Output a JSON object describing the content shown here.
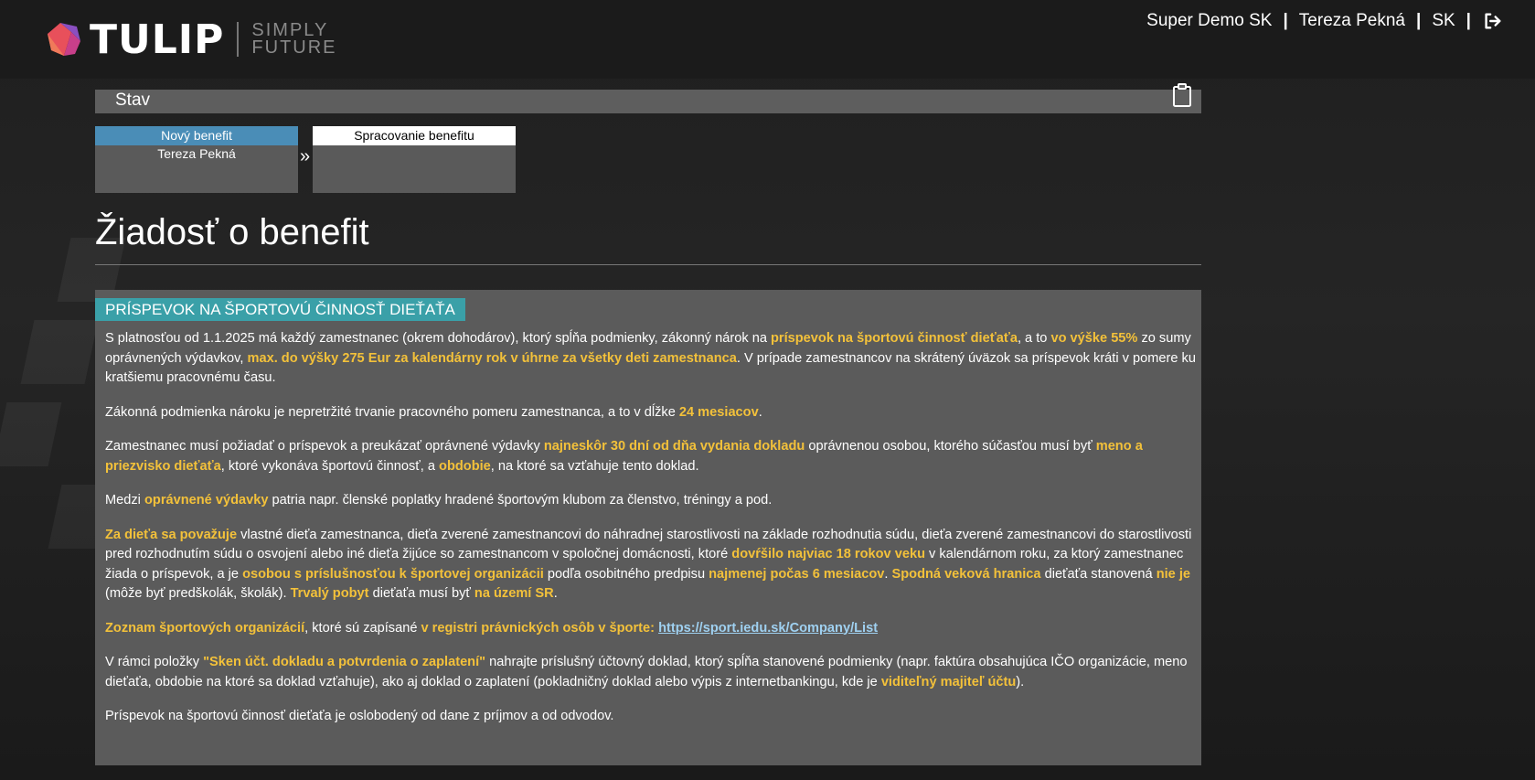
{
  "header": {
    "logo_text": "TULIP",
    "logo_tag_line1": "SIMPLY",
    "logo_tag_line2": "FUTURE",
    "company": "Super Demo SK",
    "user": "Tereza Pekná",
    "language": "SK",
    "logout_icon": "logout-icon"
  },
  "stav": {
    "title": "Stav",
    "icon": "clipboard-icon"
  },
  "workflow": {
    "steps": [
      {
        "label": "Nový benefit",
        "sub": "Tereza Pekná",
        "active": true
      },
      {
        "label": "Spracovanie benefitu",
        "sub": "",
        "active": false
      }
    ],
    "arrow": "»"
  },
  "page": {
    "title": "Žiadosť o benefit"
  },
  "section": {
    "badge": "PRÍSPEVOK NA ŠPORTOVÚ ČINNOSŤ DIEŤAŤA",
    "p1": {
      "a": "S platnosťou od 1.1.2025 má každý zamestnanec (okrem dohodárov), ktorý spĺňa podmienky, zákonný nárok na ",
      "b": "príspevok na športovú činnosť dieťaťa",
      "c": ", a to ",
      "d": "vo výške 55%",
      "e": " zo sumy oprávnených výdavkov, ",
      "f": "max. do výšky 275 Eur za kalendárny rok v úhrne za všetky deti zamestnanca",
      "g": ". V prípade zamestnancov na skrátený úväzok sa príspevok kráti v pomere ku kratšiemu pracovnému času."
    },
    "p2": {
      "a": "Zákonná podmienka nároku je nepretržité trvanie pracovného pomeru zamestnanca, a to v dĺžke ",
      "b": "24 mesiacov",
      "c": "."
    },
    "p3": {
      "a": "Zamestnanec musí požiadať o príspevok a preukázať oprávnené výdavky ",
      "b": "najneskôr 30 dní od dňa vydania dokladu",
      "c": " oprávnenou osobou, ktorého súčasťou musí byť ",
      "d": "meno a priezvisko dieťaťa",
      "e": ", ktoré vykonáva športovú činnosť, a ",
      "f": "obdobie",
      "g": ", na ktoré sa vzťahuje tento doklad."
    },
    "p4": {
      "a": "Medzi ",
      "b": "oprávnené výdavky",
      "c": " patria napr. členské poplatky hradené športovým klubom za členstvo, tréningy a pod."
    },
    "p5": {
      "a": "Za dieťa sa považuje",
      "b": " vlastné dieťa zamestnanca, dieťa zverené zamestnancovi do náhradnej starostlivosti na základe rozhodnutia súdu, dieťa zverené zamestnancovi do starostlivosti pred rozhodnutím súdu o osvojení alebo iné dieťa žijúce so zamestnancom v spoločnej domácnosti, ktoré ",
      "c": "dovŕšilo najviac 18 rokov veku",
      "d": " v kalendárnom roku, za ktorý zamestnanec žiada o príspevok, a je ",
      "e": "osobou s príslušnosťou k športovej organizácii",
      "f": " podľa osobitného predpisu ",
      "g": "najmenej počas 6 mesiacov",
      "h": ". ",
      "i": "Spodná veková hranica",
      "j": " dieťaťa stanovená ",
      "k": "nie je",
      "l": " (môže byť predškolák, školák). ",
      "m": "Trvalý pobyt",
      "n": " dieťaťa musí byť ",
      "o": "na území SR",
      "p": "."
    },
    "p6": {
      "a": "Zoznam športových organizácií",
      "b": ", ktoré sú zapísané ",
      "c": "v registri právnických osôb v športe:",
      "d": " ",
      "link": "https://sport.iedu.sk/Company/List"
    },
    "p7": {
      "a": "V rámci položky ",
      "b": "\"Sken účt. dokladu a potvrdenia o zaplatení\"",
      "c": " nahrajte príslušný účtovný doklad, ktorý spĺňa stanovené podmienky (napr. faktúra obsahujúca IČO organizácie, meno dieťaťa, obdobie na ktoré sa doklad vzťahuje), ako aj doklad o zaplatení (pokladničný doklad alebo výpis z internetbankingu, kde je ",
      "d": "viditeľný majiteľ účtu",
      "e": ")."
    },
    "p8": {
      "a": "Príspevok na športovú činnosť dieťaťa je oslobodený od dane z príjmov a od odvodov."
    }
  },
  "colors": {
    "highlight": "#f3c13a",
    "badge": "#3aa0a8",
    "active_step": "#4a8db7",
    "panel": "#5b5b5b"
  }
}
